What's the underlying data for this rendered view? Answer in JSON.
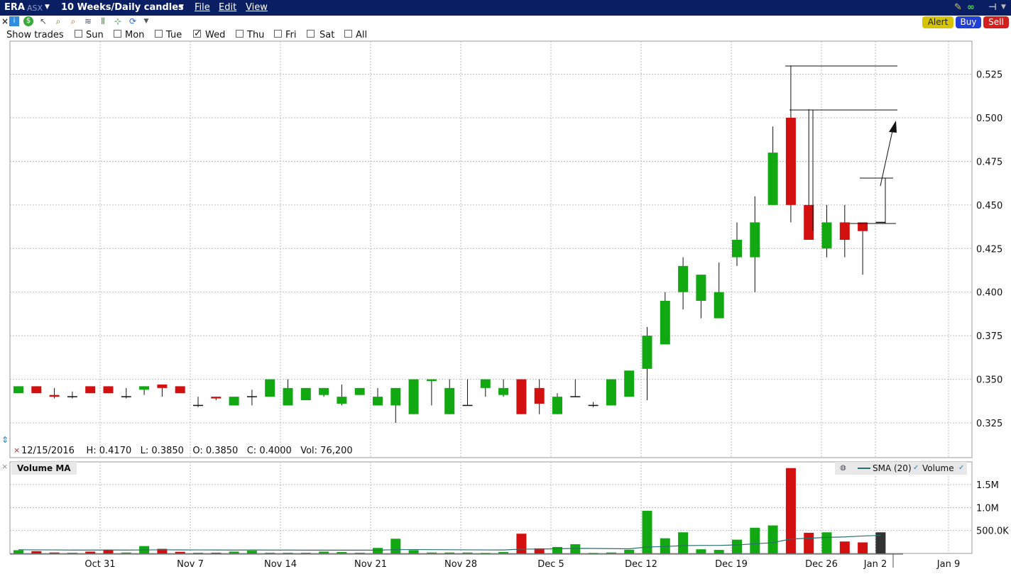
{
  "titlebar": {
    "symbol": "ERA",
    "exchange": "ASX",
    "period": "10 Weeks/Daily candles",
    "menu": [
      "File",
      "Edit",
      "View"
    ]
  },
  "toolbar": {
    "icons": [
      "close-icon",
      "info-icon",
      "dollar-icon",
      "pointer-icon",
      "zoom-in-icon",
      "zoom-out-icon",
      "draw-icon",
      "split-icon",
      "crosshair-icon",
      "refresh-icon",
      "dropdown-icon"
    ],
    "alert_label": "Alert",
    "buy_label": "Buy",
    "sell_label": "Sell",
    "alert_color": "#d6c400",
    "buy_color": "#1f3fd6",
    "sell_color": "#d41f1f"
  },
  "show_trades": {
    "label": "Show trades",
    "days": [
      {
        "label": "Sun",
        "checked": false
      },
      {
        "label": "Mon",
        "checked": false
      },
      {
        "label": "Tue",
        "checked": false
      },
      {
        "label": "Wed",
        "checked": true
      },
      {
        "label": "Thu",
        "checked": false
      },
      {
        "label": "Fri",
        "checked": false
      },
      {
        "label": "Sat",
        "checked": false
      },
      {
        "label": "All",
        "checked": false
      }
    ]
  },
  "info_bar": {
    "date": "12/15/2016",
    "high": "H: 0.4170",
    "low": "L: 0.3850",
    "open": "O: 0.3850",
    "close": "C: 0.4000",
    "volume": "Vol: 76,200"
  },
  "volume_panel": {
    "title": "Volume MA",
    "legend_sma": "SMA (20)",
    "legend_volume": "Volume"
  },
  "colors": {
    "up": "#11a811",
    "down": "#d40f0f",
    "current": "#333333",
    "sma": "#2a6f6f"
  },
  "chart_data": {
    "type": "candlestick",
    "x_axis_labels": [
      "Oct 31",
      "Nov 7",
      "Nov 14",
      "Nov 21",
      "Nov 28",
      "Dec 5",
      "Dec 12",
      "Dec 19",
      "Dec 26",
      "Jan 2",
      "Jan 9"
    ],
    "y_ticks": [
      "0.525",
      "0.500",
      "0.475",
      "0.450",
      "0.425",
      "0.400",
      "0.375",
      "0.350",
      "0.325"
    ],
    "ylim": [
      0.305,
      0.545
    ],
    "volume_ticks": [
      "1.5M",
      "1.0M",
      "500.0K"
    ],
    "volume_ylim": [
      0,
      1900000
    ],
    "grid": true,
    "candles": [
      {
        "o": 0.342,
        "h": 0.346,
        "l": 0.342,
        "c": 0.346,
        "v": 70000
      },
      {
        "o": 0.346,
        "h": 0.346,
        "l": 0.342,
        "c": 0.342,
        "v": 50000
      },
      {
        "o": 0.341,
        "h": 0.345,
        "l": 0.339,
        "c": 0.34,
        "v": 20000
      },
      {
        "o": 0.34,
        "h": 0.343,
        "l": 0.339,
        "c": 0.34,
        "v": 15000
      },
      {
        "o": 0.346,
        "h": 0.346,
        "l": 0.342,
        "c": 0.342,
        "v": 40000
      },
      {
        "o": 0.346,
        "h": 0.346,
        "l": 0.342,
        "c": 0.342,
        "v": 80000
      },
      {
        "o": 0.34,
        "h": 0.345,
        "l": 0.339,
        "c": 0.34,
        "v": 20000
      },
      {
        "o": 0.344,
        "h": 0.346,
        "l": 0.341,
        "c": 0.346,
        "v": 160000
      },
      {
        "o": 0.347,
        "h": 0.347,
        "l": 0.34,
        "c": 0.345,
        "v": 100000
      },
      {
        "o": 0.346,
        "h": 0.346,
        "l": 0.342,
        "c": 0.342,
        "v": 35000
      },
      {
        "o": 0.335,
        "h": 0.34,
        "l": 0.334,
        "c": 0.335,
        "v": 15000
      },
      {
        "o": 0.34,
        "h": 0.34,
        "l": 0.338,
        "c": 0.339,
        "v": 15000
      },
      {
        "o": 0.335,
        "h": 0.34,
        "l": 0.335,
        "c": 0.34,
        "v": 40000
      },
      {
        "o": 0.34,
        "h": 0.344,
        "l": 0.335,
        "c": 0.34,
        "v": 60000
      },
      {
        "o": 0.34,
        "h": 0.35,
        "l": 0.34,
        "c": 0.35,
        "v": 15000
      },
      {
        "o": 0.335,
        "h": 0.35,
        "l": 0.335,
        "c": 0.345,
        "v": 15000
      },
      {
        "o": 0.338,
        "h": 0.345,
        "l": 0.338,
        "c": 0.345,
        "v": 15000
      },
      {
        "o": 0.341,
        "h": 0.345,
        "l": 0.34,
        "c": 0.345,
        "v": 40000
      },
      {
        "o": 0.336,
        "h": 0.347,
        "l": 0.335,
        "c": 0.34,
        "v": 30000
      },
      {
        "o": 0.341,
        "h": 0.345,
        "l": 0.341,
        "c": 0.345,
        "v": 15000
      },
      {
        "o": 0.335,
        "h": 0.345,
        "l": 0.335,
        "c": 0.34,
        "v": 120000
      },
      {
        "o": 0.335,
        "h": 0.345,
        "l": 0.325,
        "c": 0.345,
        "v": 320000
      },
      {
        "o": 0.33,
        "h": 0.35,
        "l": 0.33,
        "c": 0.35,
        "v": 70000
      },
      {
        "o": 0.349,
        "h": 0.35,
        "l": 0.335,
        "c": 0.35,
        "v": 20000
      },
      {
        "o": 0.33,
        "h": 0.35,
        "l": 0.33,
        "c": 0.345,
        "v": 20000
      },
      {
        "o": 0.335,
        "h": 0.35,
        "l": 0.335,
        "c": 0.335,
        "v": 20000
      },
      {
        "o": 0.345,
        "h": 0.35,
        "l": 0.34,
        "c": 0.35,
        "v": 10000
      },
      {
        "o": 0.341,
        "h": 0.35,
        "l": 0.34,
        "c": 0.345,
        "v": 30000
      },
      {
        "o": 0.35,
        "h": 0.35,
        "l": 0.33,
        "c": 0.33,
        "v": 430000
      },
      {
        "o": 0.345,
        "h": 0.35,
        "l": 0.33,
        "c": 0.336,
        "v": 110000
      },
      {
        "o": 0.33,
        "h": 0.342,
        "l": 0.33,
        "c": 0.34,
        "v": 140000
      },
      {
        "o": 0.34,
        "h": 0.35,
        "l": 0.34,
        "c": 0.34,
        "v": 200000
      },
      {
        "o": 0.335,
        "h": 0.337,
        "l": 0.334,
        "c": 0.335,
        "v": 10000
      },
      {
        "o": 0.335,
        "h": 0.35,
        "l": 0.335,
        "c": 0.35,
        "v": 20000
      },
      {
        "o": 0.34,
        "h": 0.355,
        "l": 0.34,
        "c": 0.355,
        "v": 80000
      },
      {
        "o": 0.356,
        "h": 0.38,
        "l": 0.338,
        "c": 0.375,
        "v": 930000
      },
      {
        "o": 0.37,
        "h": 0.4,
        "l": 0.37,
        "c": 0.395,
        "v": 330000
      },
      {
        "o": 0.4,
        "h": 0.42,
        "l": 0.39,
        "c": 0.415,
        "v": 460000
      },
      {
        "o": 0.395,
        "h": 0.41,
        "l": 0.385,
        "c": 0.41,
        "v": 90000
      },
      {
        "o": 0.385,
        "h": 0.417,
        "l": 0.385,
        "c": 0.4,
        "v": 76200
      },
      {
        "o": 0.42,
        "h": 0.44,
        "l": 0.415,
        "c": 0.43,
        "v": 300000
      },
      {
        "o": 0.42,
        "h": 0.455,
        "l": 0.4,
        "c": 0.44,
        "v": 560000
      },
      {
        "o": 0.45,
        "h": 0.495,
        "l": 0.45,
        "c": 0.48,
        "v": 610000
      },
      {
        "o": 0.5,
        "h": 0.53,
        "l": 0.44,
        "c": 0.45,
        "v": 1860000
      },
      {
        "o": 0.45,
        "h": 0.505,
        "l": 0.43,
        "c": 0.43,
        "v": 450000
      },
      {
        "o": 0.425,
        "h": 0.45,
        "l": 0.42,
        "c": 0.44,
        "v": 460000
      },
      {
        "o": 0.44,
        "h": 0.45,
        "l": 0.42,
        "c": 0.43,
        "v": 260000
      },
      {
        "o": 0.44,
        "h": 0.44,
        "l": 0.41,
        "c": 0.435,
        "v": 240000
      },
      {
        "o": 0.44,
        "h": 0.44,
        "l": 0.44,
        "c": 0.44,
        "v": 460000,
        "current": true
      }
    ],
    "sma20": [
      80000,
      78000,
      76000,
      74000,
      74000,
      75000,
      74000,
      76000,
      78000,
      77000,
      76000,
      75000,
      74000,
      75000,
      74000,
      73000,
      72000,
      72000,
      72000,
      71000,
      72000,
      82000,
      84000,
      82000,
      80000,
      78000,
      76000,
      75000,
      94000,
      96000,
      100000,
      110000,
      108000,
      104000,
      100000,
      140000,
      150000,
      170000,
      175000,
      175000,
      185000,
      210000,
      235000,
      315000,
      330000,
      350000,
      360000,
      380000,
      395000
    ]
  }
}
